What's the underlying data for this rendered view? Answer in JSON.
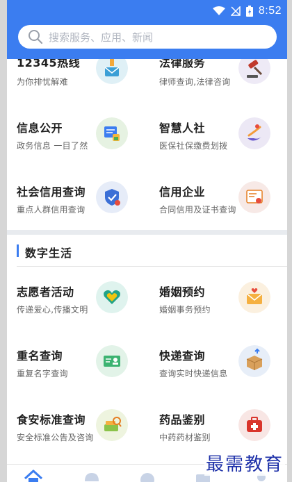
{
  "status": {
    "time": "8:52"
  },
  "search": {
    "placeholder": "搜索服务、应用、新闻"
  },
  "top_grid": [
    {
      "title": "12345热线",
      "subtitle": "为你排忧解难",
      "icon": "mailbox-icon"
    },
    {
      "title": "法律服务",
      "subtitle": "律师查询,法律咨询",
      "icon": "gavel-icon"
    },
    {
      "title": "信息公开",
      "subtitle": "政务信息 一目了然",
      "icon": "document-icon"
    },
    {
      "title": "智慧人社",
      "subtitle": "医保社保缴费划拨",
      "icon": "swirl-icon"
    },
    {
      "title": "社会信用查询",
      "subtitle": "重点人群信用查询",
      "icon": "shield-icon"
    },
    {
      "title": "信用企业",
      "subtitle": "合同信用及证书查询",
      "icon": "certificate-icon"
    }
  ],
  "section": {
    "title": "数字生活"
  },
  "life_grid": [
    {
      "title": "志愿者活动",
      "subtitle": "传递爱心,传播文明",
      "icon": "heart-hands-icon"
    },
    {
      "title": "婚姻预约",
      "subtitle": "婚姻事务预约",
      "icon": "envelope-heart-icon"
    },
    {
      "title": "重名查询",
      "subtitle": "重复名字查询",
      "icon": "id-card-icon"
    },
    {
      "title": "快递查询",
      "subtitle": "查询实时快递信息",
      "icon": "package-icon"
    },
    {
      "title": "食安标准查询",
      "subtitle": "安全标准公告及咨询",
      "icon": "food-search-icon"
    },
    {
      "title": "药品鉴别",
      "subtitle": "中药药材鉴别",
      "icon": "medicine-box-icon"
    }
  ],
  "watermark": "最需教育",
  "colors": {
    "brand": "#3b7df0",
    "bg": "#ffffff",
    "divider": "#e8ebef"
  }
}
